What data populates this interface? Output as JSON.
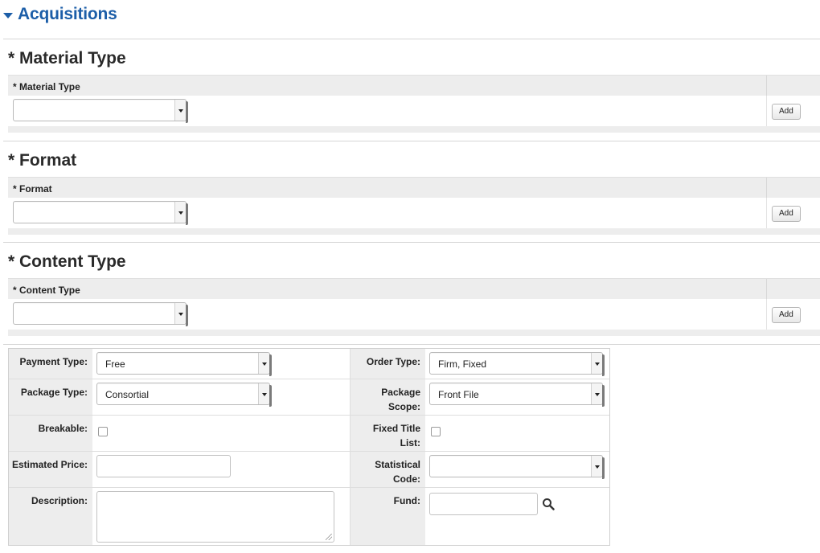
{
  "header": {
    "title": "Acquisitions"
  },
  "sections": [
    {
      "title": "* Material Type",
      "column_label": "* Material Type",
      "select_value": "",
      "add_label": "Add"
    },
    {
      "title": "* Format",
      "column_label": "* Format",
      "select_value": "",
      "add_label": "Add"
    },
    {
      "title": "* Content Type",
      "column_label": "* Content Type",
      "select_value": "",
      "add_label": "Add"
    }
  ],
  "order": {
    "payment_type": {
      "label": "Payment Type:",
      "value": "Free"
    },
    "order_type": {
      "label": "Order Type:",
      "value": "Firm, Fixed"
    },
    "package_type": {
      "label": "Package Type:",
      "value": "Consortial"
    },
    "package_scope": {
      "label": "Package Scope:",
      "value": "Front File"
    },
    "breakable": {
      "label": "Breakable:",
      "checked": false
    },
    "fixed_title_list": {
      "label": "Fixed Title List:",
      "checked": false
    },
    "estimated_price": {
      "label": "Estimated Price:",
      "value": ""
    },
    "statistical_code": {
      "label": "Statistical Code:",
      "value": ""
    },
    "description": {
      "label": "Description:",
      "value": ""
    },
    "fund": {
      "label": "Fund:",
      "value": ""
    }
  },
  "icons": {
    "header_caret": "caret-down-icon",
    "fund_search": "search-icon"
  },
  "colors": {
    "accent": "#1c5ea8",
    "header_bg": "#ededed"
  }
}
